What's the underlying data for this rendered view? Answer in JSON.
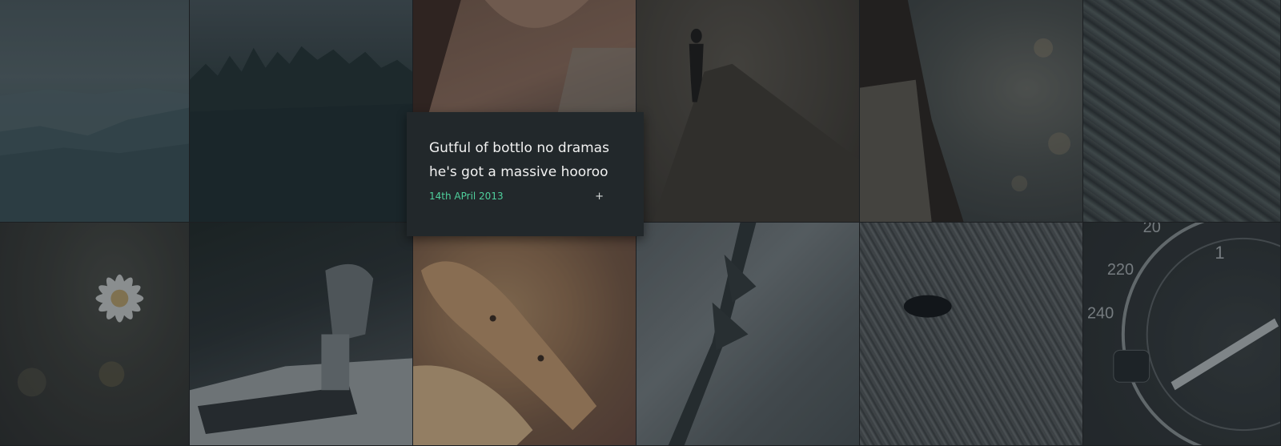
{
  "tiles": [
    {
      "id": "hills",
      "icon": "mountains-photo"
    },
    {
      "id": "forest",
      "icon": "forest-photo"
    },
    {
      "id": "face",
      "icon": "portrait-photo"
    },
    {
      "id": "road",
      "icon": "road-photo"
    },
    {
      "id": "hair",
      "icon": "hair-photo"
    },
    {
      "id": "rope",
      "icon": "rope-photo"
    },
    {
      "id": "daisy",
      "icon": "daisy-photo"
    },
    {
      "id": "car",
      "icon": "gear-shift-photo"
    },
    {
      "id": "food",
      "icon": "food-photo"
    },
    {
      "id": "plant",
      "icon": "plant-photo"
    },
    {
      "id": "bird",
      "icon": "bird-photo"
    },
    {
      "id": "gauge",
      "icon": "speedometer-photo"
    }
  ],
  "card": {
    "title": "Gutful of bottlo no dramas he's got a massive hooroo",
    "date": "14th APril 2013",
    "plus": "+"
  },
  "gauge": {
    "labels": [
      "20",
      "220",
      "240",
      "1"
    ]
  },
  "colors": {
    "card_bg": "#22282b",
    "date_accent": "#4fcf9c",
    "title_text": "#f1f1f1"
  }
}
